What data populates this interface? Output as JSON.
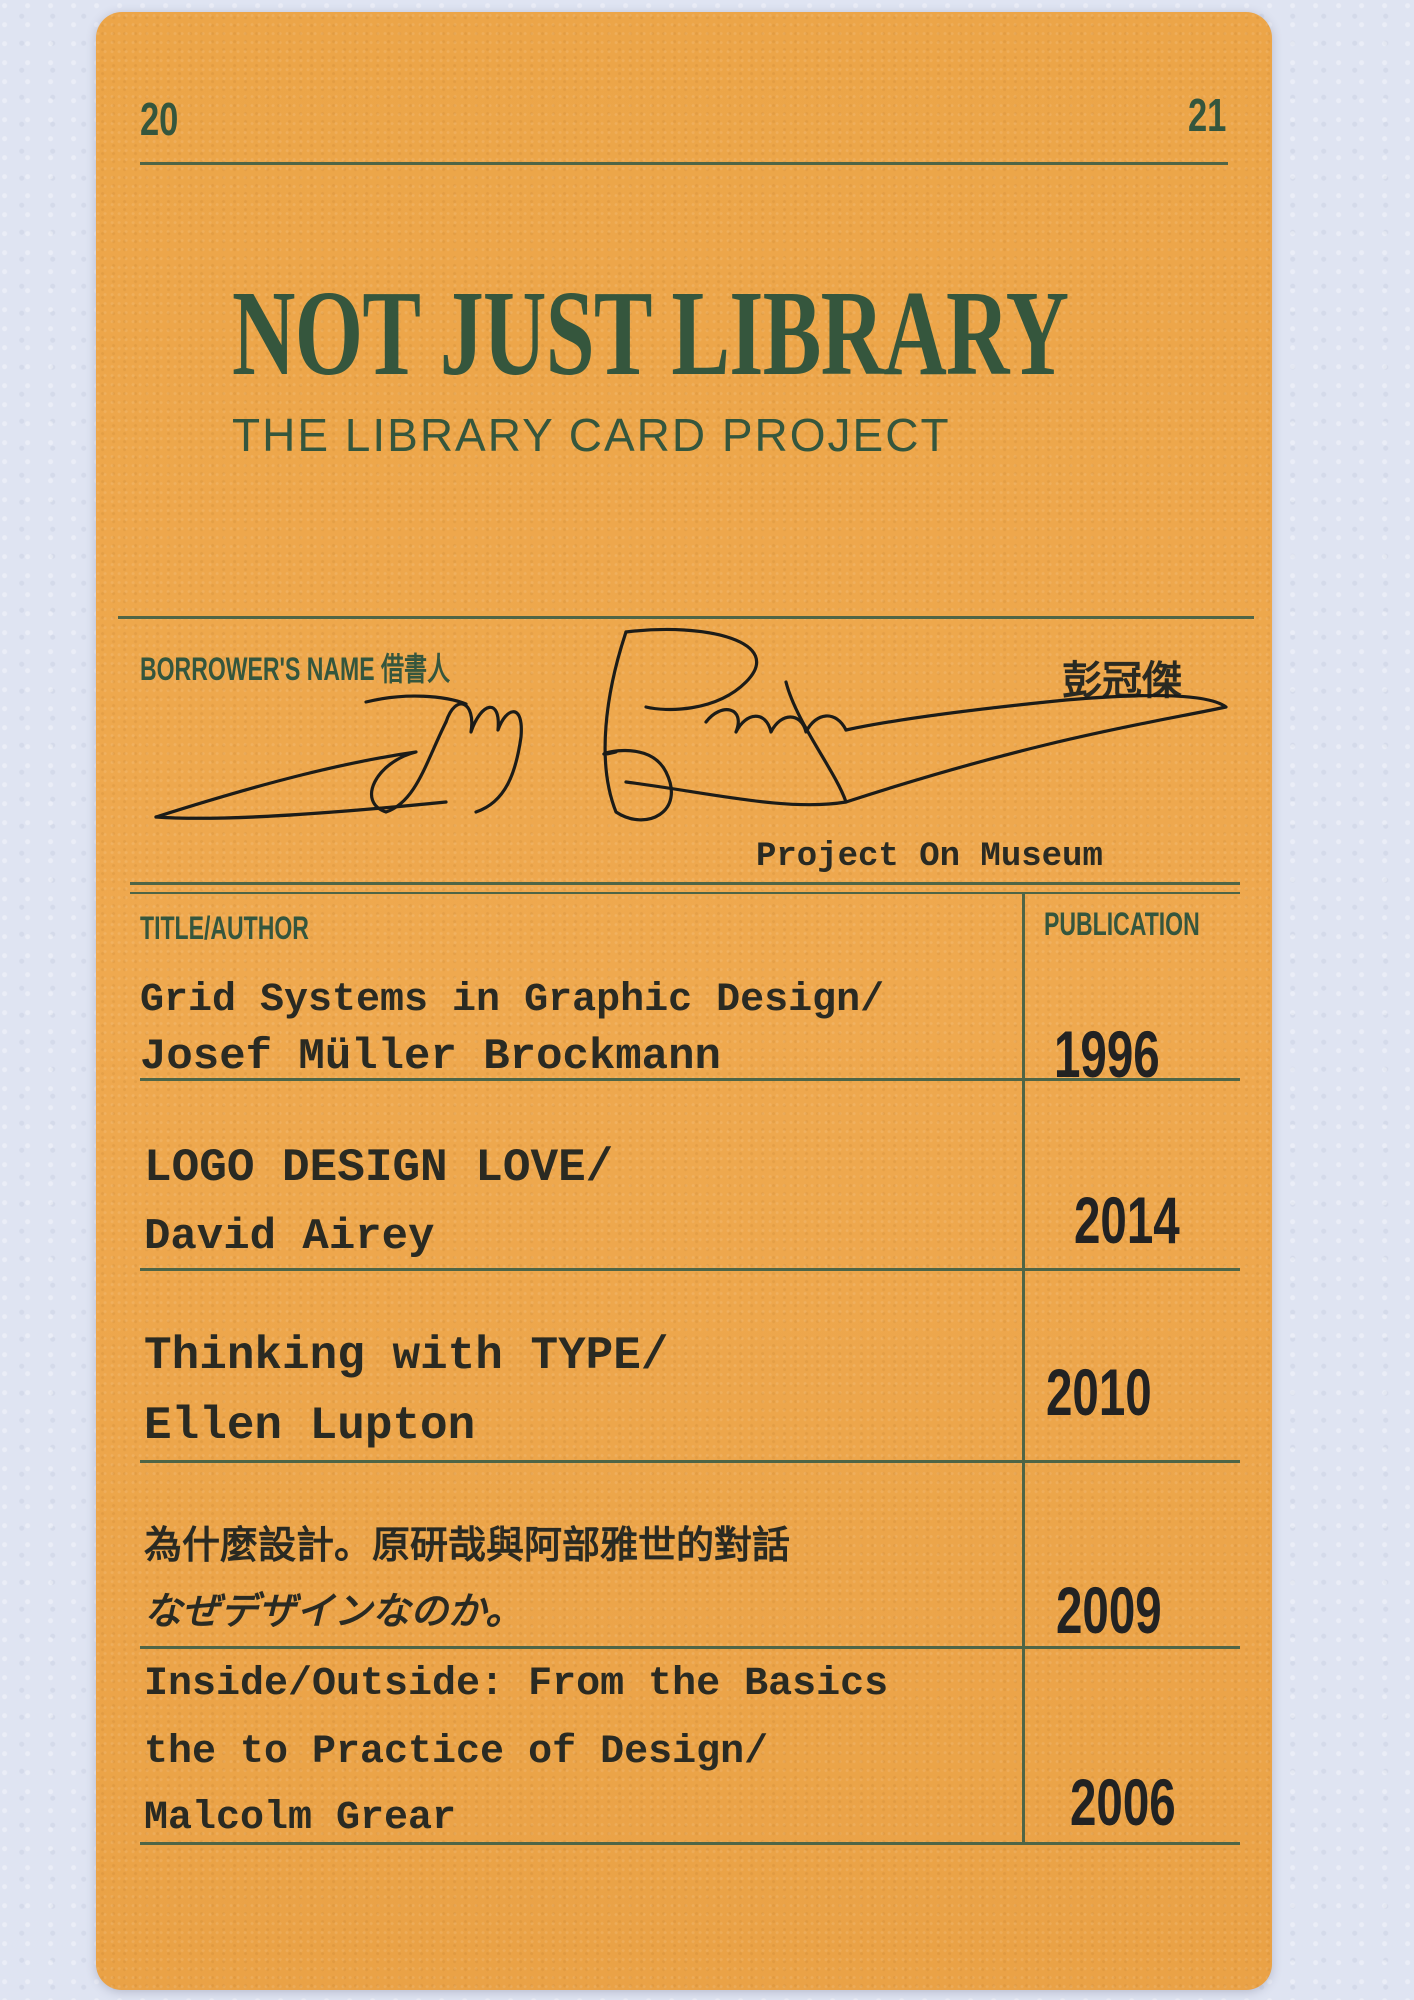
{
  "header": {
    "year_left": "20",
    "year_right": "21"
  },
  "title": {
    "main": "NOT JUST LIBRARY",
    "sub": "THE LIBRARY CARD PROJECT"
  },
  "borrower": {
    "label": "BORROWER'S NAME 借書人",
    "name_cjk": "彭冠傑",
    "affiliation": "Project On Museum"
  },
  "table": {
    "col_title": "TITLE/AUTHOR",
    "col_publication": "PUBLICATION",
    "rows": [
      {
        "line1": "Grid Systems in Graphic Design/",
        "line2": "Josef Müller Brockmann",
        "year": "1996"
      },
      {
        "line1": "LOGO DESIGN LOVE/",
        "line2": "David Airey",
        "year": "2014"
      },
      {
        "line1": "Thinking with TYPE/",
        "line2": "Ellen Lupton",
        "year": "2010"
      },
      {
        "line1": "為什麼設計。原研哉與阿部雅世的對話",
        "line2": "なぜデザインなのか。",
        "year": "2009"
      },
      {
        "line1": "Inside/Outside: From the Basics",
        "line2": "the to Practice of Design/",
        "line3": "Malcolm Grear",
        "year": "2006"
      }
    ]
  },
  "colors": {
    "card": "#eea64c",
    "ink_green": "#35563d",
    "ink_black": "#2a2a22",
    "background": "#dfe4f2"
  }
}
